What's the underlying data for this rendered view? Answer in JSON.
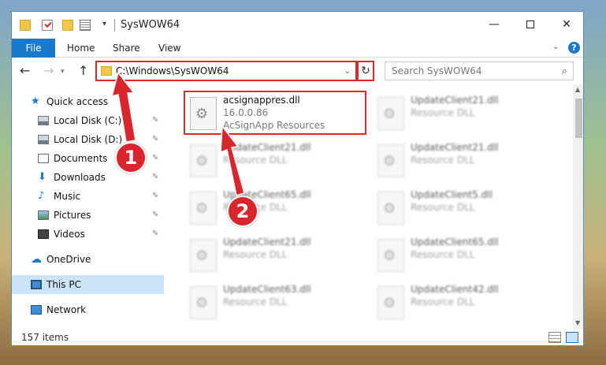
{
  "window": {
    "title": "SysWOW64",
    "minimize": "—",
    "close": "✕"
  },
  "ribbon": {
    "tabs": [
      "File",
      "Home",
      "Share",
      "View"
    ],
    "help": "?"
  },
  "nav": {
    "back": "←",
    "forward": "→",
    "up": "↑",
    "address": "C:\\Windows\\SysWOW64",
    "refresh": "↻",
    "search_placeholder": "Search SysWOW64"
  },
  "sidebar": {
    "items": [
      {
        "label": "Quick access",
        "icon": "star-icon"
      },
      {
        "label": "Local Disk (C:)",
        "icon": "disk-icon",
        "pinned": true
      },
      {
        "label": "Local Disk (D:)",
        "icon": "disk-icon",
        "pinned": true
      },
      {
        "label": "Documents",
        "icon": "documents-icon",
        "pinned": true
      },
      {
        "label": "Downloads",
        "icon": "downloads-icon",
        "pinned": true
      },
      {
        "label": "Music",
        "icon": "music-icon",
        "pinned": true
      },
      {
        "label": "Pictures",
        "icon": "pictures-icon",
        "pinned": true
      },
      {
        "label": "Videos",
        "icon": "videos-icon",
        "pinned": true
      },
      {
        "label": "OneDrive",
        "icon": "onedrive-icon"
      },
      {
        "label": "This PC",
        "icon": "pc-icon",
        "selected": true
      },
      {
        "label": "Network",
        "icon": "network-icon"
      }
    ]
  },
  "files": {
    "highlighted": {
      "name": "acsignappres.dll",
      "version": "16.0.0.86",
      "description": "AcSignApp Resources"
    },
    "blurred": [
      {
        "name": "UpdateClient21.dll",
        "description": "Resource DLL"
      },
      {
        "name": "UpdateClient21.dll",
        "description": "Resource DLL"
      },
      {
        "name": "UpdateClient21.dll",
        "description": "Resource DLL"
      },
      {
        "name": "UpdateClient65.dll",
        "description": "Resource DLL"
      },
      {
        "name": "UpdateClient5.dll",
        "description": "Resource DLL"
      },
      {
        "name": "UpdateClient21.dll",
        "description": "Resource DLL"
      },
      {
        "name": "UpdateClient65.dll",
        "description": "Resource DLL"
      },
      {
        "name": "UpdateClient63.dll",
        "description": "Resource DLL"
      },
      {
        "name": "UpdateClient42.dll",
        "description": "Resource DLL"
      }
    ]
  },
  "status": {
    "items": "157 items"
  },
  "annotations": {
    "badge1": "1",
    "badge2": "2",
    "color": "#d8262c"
  }
}
